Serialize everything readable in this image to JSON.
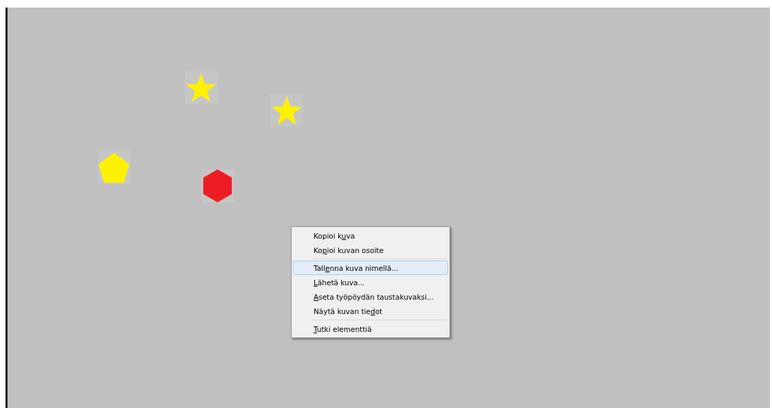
{
  "canvas": {
    "shapes": [
      {
        "kind": "star",
        "color": "#fff200"
      },
      {
        "kind": "star",
        "color": "#fff200"
      },
      {
        "kind": "pentagon",
        "color": "#fff200"
      },
      {
        "kind": "hexagon",
        "color": "#ed1c24"
      }
    ]
  },
  "context_menu": {
    "items": [
      {
        "kind": "item",
        "before": "Kopioi k",
        "key": "u",
        "after": "va",
        "selected": false
      },
      {
        "kind": "item",
        "before": "Ko",
        "key": "p",
        "after": "ioi kuvan osoite",
        "selected": false
      },
      {
        "kind": "separator"
      },
      {
        "kind": "item",
        "before": "Tall",
        "key": "e",
        "after": "nna kuva nimellä...",
        "selected": true
      },
      {
        "kind": "item",
        "key": "L",
        "after": "ähetä kuva...",
        "selected": false
      },
      {
        "kind": "item",
        "key": "A",
        "after": "seta työpöydän taustakuvaksi...",
        "selected": false
      },
      {
        "kind": "item",
        "before": "Näytä kuvan tie",
        "key": "d",
        "after": "ot",
        "selected": false
      },
      {
        "kind": "separator"
      },
      {
        "kind": "item",
        "key": "T",
        "after": "utki elementtiä",
        "selected": false
      }
    ]
  }
}
